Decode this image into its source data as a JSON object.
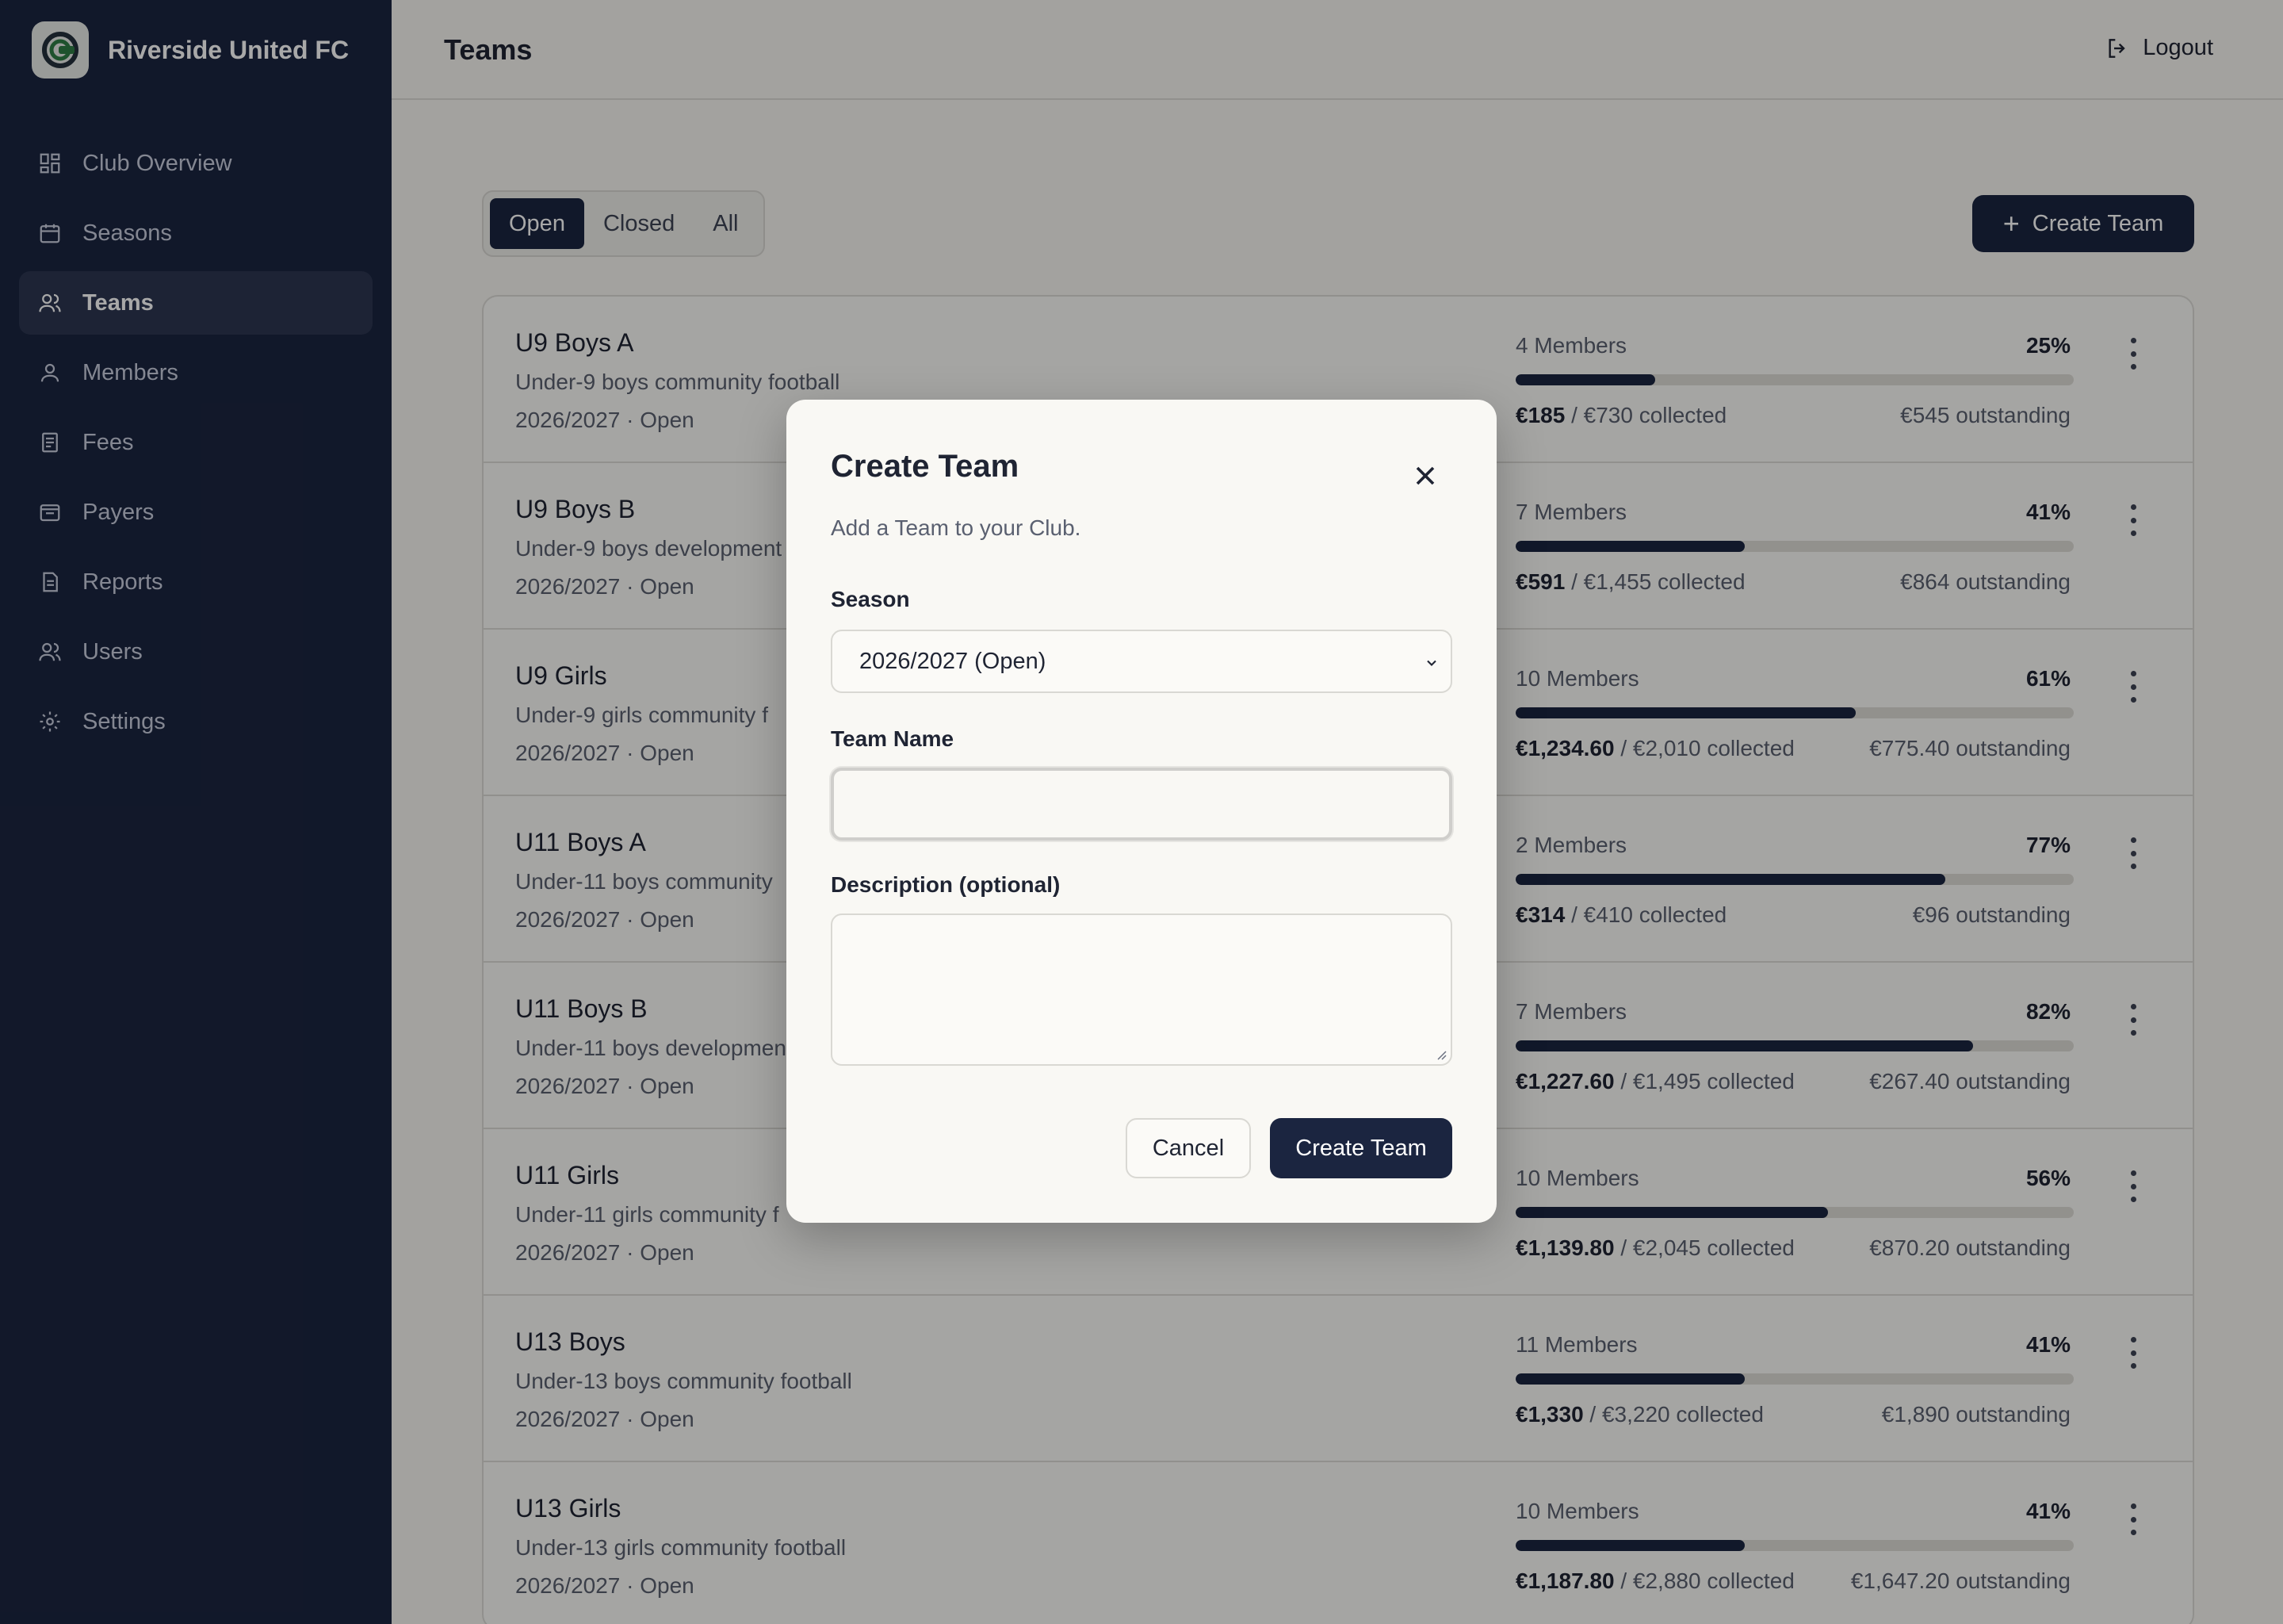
{
  "brand": {
    "name": "Riverside United FC"
  },
  "sidebar": {
    "items": [
      {
        "label": "Club Overview",
        "icon": "grid-icon"
      },
      {
        "label": "Seasons",
        "icon": "calendar-icon"
      },
      {
        "label": "Teams",
        "icon": "users-icon",
        "active": true
      },
      {
        "label": "Members",
        "icon": "user-icon"
      },
      {
        "label": "Fees",
        "icon": "receipt-icon"
      },
      {
        "label": "Payers",
        "icon": "wallet-icon"
      },
      {
        "label": "Reports",
        "icon": "document-icon"
      },
      {
        "label": "Users",
        "icon": "users-icon"
      },
      {
        "label": "Settings",
        "icon": "gear-icon"
      }
    ]
  },
  "header": {
    "title": "Teams",
    "logout_label": "Logout"
  },
  "filters": {
    "tabs": [
      "Open",
      "Closed",
      "All"
    ],
    "active": "Open"
  },
  "toolbar": {
    "create_label": "Create Team"
  },
  "teams": [
    {
      "name": "U9 Boys A",
      "description": "Under-9 boys community football",
      "season": "2026/2027 · Open",
      "members": "4 Members",
      "percent": "25%",
      "collected": "€185",
      "total": " / €730 collected",
      "outstanding": "€545 outstanding"
    },
    {
      "name": "U9 Boys B",
      "description": "Under-9 boys development",
      "season": "2026/2027 · Open",
      "members": "7 Members",
      "percent": "41%",
      "collected": "€591",
      "total": " / €1,455 collected",
      "outstanding": "€864 outstanding"
    },
    {
      "name": "U9 Girls",
      "description": "Under-9 girls community f",
      "season": "2026/2027 · Open",
      "members": "10 Members",
      "percent": "61%",
      "collected": "€1,234.60",
      "total": " / €2,010 collected",
      "outstanding": "€775.40 outstanding"
    },
    {
      "name": "U11 Boys A",
      "description": "Under-11 boys community",
      "season": "2026/2027 · Open",
      "members": "2 Members",
      "percent": "77%",
      "collected": "€314",
      "total": " / €410 collected",
      "outstanding": "€96 outstanding"
    },
    {
      "name": "U11 Boys B",
      "description": "Under-11 boys developmen",
      "season": "2026/2027 · Open",
      "members": "7 Members",
      "percent": "82%",
      "collected": "€1,227.60",
      "total": " / €1,495 collected",
      "outstanding": "€267.40 outstanding"
    },
    {
      "name": "U11 Girls",
      "description": "Under-11 girls community f",
      "season": "2026/2027 · Open",
      "members": "10 Members",
      "percent": "56%",
      "collected": "€1,139.80",
      "total": " / €2,045 collected",
      "outstanding": "€870.20 outstanding"
    },
    {
      "name": "U13 Boys",
      "description": "Under-13 boys community football",
      "season": "2026/2027 · Open",
      "members": "11 Members",
      "percent": "41%",
      "collected": "€1,330",
      "total": " / €3,220 collected",
      "outstanding": "€1,890 outstanding"
    },
    {
      "name": "U13 Girls",
      "description": "Under-13 girls community football",
      "season": "2026/2027 · Open",
      "members": "10 Members",
      "percent": "41%",
      "collected": "€1,187.80",
      "total": " / €2,880 collected",
      "outstanding": "€1,647.20 outstanding"
    }
  ],
  "modal": {
    "title": "Create Team",
    "subtitle": "Add a Team to your Club.",
    "season_label": "Season",
    "season_value": "2026/2027 (Open)",
    "team_name_label": "Team Name",
    "team_name_value": "",
    "description_label": "Description (optional)",
    "description_value": "",
    "cancel_label": "Cancel",
    "submit_label": "Create Team"
  },
  "colors": {
    "sidebar": "#1b2540",
    "accent": "#1b2540",
    "logo_green": "#2e7d45"
  }
}
